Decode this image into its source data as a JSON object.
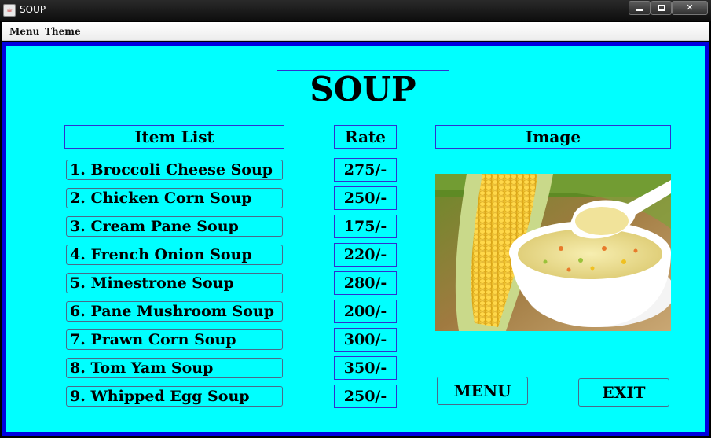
{
  "window": {
    "title": "SOUP",
    "icon": "java-cup-icon",
    "controls": {
      "minimize": "minimize-icon",
      "maximize": "maximize-icon",
      "close": "✕"
    }
  },
  "menubar": {
    "items": [
      "Menu",
      "Theme"
    ]
  },
  "page": {
    "title": "SOUP",
    "headers": {
      "items": "Item List",
      "rate": "Rate",
      "image": "Image"
    },
    "items": [
      {
        "name": "1. Broccoli Cheese Soup",
        "rate": "275/-"
      },
      {
        "name": "2. Chicken Corn Soup",
        "rate": "250/-"
      },
      {
        "name": "3. Cream Pane Soup",
        "rate": "175/-"
      },
      {
        "name": "4. French Onion Soup",
        "rate": "220/-"
      },
      {
        "name": "5. Minestrone Soup",
        "rate": "280/-"
      },
      {
        "name": "6. Pane Mushroom Soup",
        "rate": "200/-"
      },
      {
        "name": "7. Prawn Corn Soup",
        "rate": "300/-"
      },
      {
        "name": "8. Tom Yam Soup",
        "rate": "350/-"
      },
      {
        "name": "9. Whipped Egg Soup",
        "rate": "250/-"
      }
    ],
    "image": "corn-soup-photo",
    "buttons": {
      "menu": "MENU",
      "exit": "EXIT"
    }
  },
  "colors": {
    "background": "#00ffff",
    "border": "#0000e0",
    "box_border": "#3030d0"
  }
}
